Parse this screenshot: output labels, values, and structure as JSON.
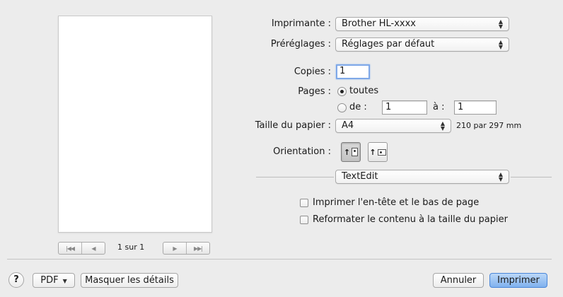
{
  "preview": {
    "page_label": "1 sur 1",
    "nav_first_prev": [
      "|◀◀",
      "◀"
    ],
    "nav_next_last": [
      "▶",
      "▶▶|"
    ]
  },
  "printer": {
    "label": "Imprimante :",
    "value": "Brother HL-xxxx"
  },
  "presets": {
    "label": "Préréglages :",
    "value": "Réglages par défaut"
  },
  "copies": {
    "label": "Copies :",
    "value": "1"
  },
  "pages": {
    "label": "Pages :",
    "all_label": "toutes",
    "from_label": "de :",
    "from_value": "1",
    "to_label": "à :",
    "to_value": "1",
    "selected": "all"
  },
  "paper": {
    "label": "Taille du papier :",
    "value": "A4",
    "dimensions": "210 par 297 mm"
  },
  "orientation": {
    "label": "Orientation :",
    "selected": "portrait"
  },
  "section": {
    "value": "TextEdit"
  },
  "options": {
    "header_footer": {
      "label": "Imprimer l'en-tête et le bas de page",
      "checked": false
    },
    "rewrap": {
      "label": "Reformater le contenu à la taille du papier",
      "checked": false
    }
  },
  "footer": {
    "help": "?",
    "pdf": "PDF",
    "hide_details": "Masquer les détails",
    "cancel": "Annuler",
    "print": "Imprimer"
  },
  "colors": {
    "default_button": "#7fb1ee",
    "focus_ring": "#7fa8e8",
    "background": "#ececec"
  }
}
